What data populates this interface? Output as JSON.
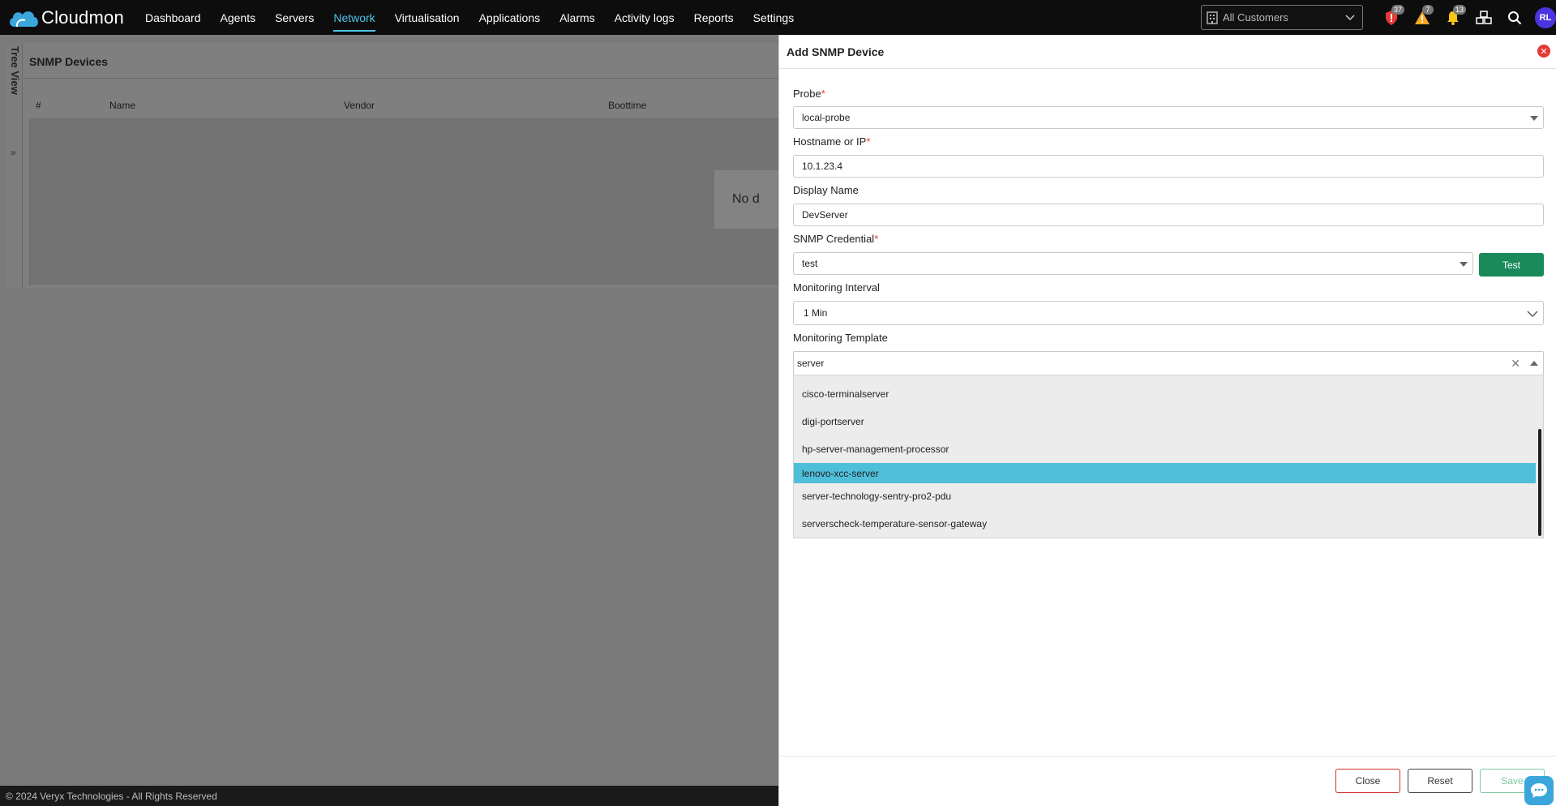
{
  "app": {
    "name": "Cloudmon"
  },
  "nav": [
    {
      "label": "Dashboard",
      "active": false
    },
    {
      "label": "Agents",
      "active": false
    },
    {
      "label": "Servers",
      "active": false
    },
    {
      "label": "Network",
      "active": true
    },
    {
      "label": "Virtualisation",
      "active": false
    },
    {
      "label": "Applications",
      "active": false
    },
    {
      "label": "Alarms",
      "active": false
    },
    {
      "label": "Activity logs",
      "active": false
    },
    {
      "label": "Reports",
      "active": false
    },
    {
      "label": "Settings",
      "active": false
    }
  ],
  "customer_select": {
    "value": "All Customers"
  },
  "top_icons": {
    "critical_count": "37",
    "warning_count": "7",
    "notification_count": "13",
    "avatar_initials": "RL"
  },
  "colors": {
    "accent": "#4fc3e8",
    "brand_cloud": "#3aa6dc",
    "test_button": "#1a8a5a",
    "close_red": "#e53935",
    "highlight": "#4fbfd9",
    "avatar": "#4a35e0"
  },
  "tree_view": {
    "label": "Tree View"
  },
  "background_page": {
    "title": "SNMP Devices",
    "columns": [
      "#",
      "Name",
      "Vendor",
      "Boottime"
    ],
    "empty_text": "No d"
  },
  "footer": {
    "copyright": "© 2024 Veryx Technologies - All Rights Reserved"
  },
  "drawer": {
    "title": "Add SNMP Device",
    "probe": {
      "label": "Probe",
      "value": "local-probe"
    },
    "hostname": {
      "label": "Hostname or IP",
      "value": "10.1.23.4"
    },
    "display_name": {
      "label": "Display Name",
      "value": "DevServer"
    },
    "snmp_credential": {
      "label": "SNMP Credential",
      "value": "test",
      "test_label": "Test"
    },
    "monitoring_interval": {
      "label": "Monitoring Interval",
      "value": "1 Min"
    },
    "monitoring_template": {
      "label": "Monitoring Template",
      "search_value": "server",
      "options": [
        {
          "label": "cisco-terminalserver",
          "highlighted": false
        },
        {
          "label": "digi-portserver",
          "highlighted": false
        },
        {
          "label": "hp-server-management-processor",
          "highlighted": false
        },
        {
          "label": "lenovo-xcc-server",
          "highlighted": true
        },
        {
          "label": "server-technology-sentry-pro2-pdu",
          "highlighted": false
        },
        {
          "label": "serverscheck-temperature-sensor-gateway",
          "highlighted": false
        }
      ]
    },
    "buttons": {
      "close": "Close",
      "reset": "Reset",
      "save": "Save"
    }
  }
}
